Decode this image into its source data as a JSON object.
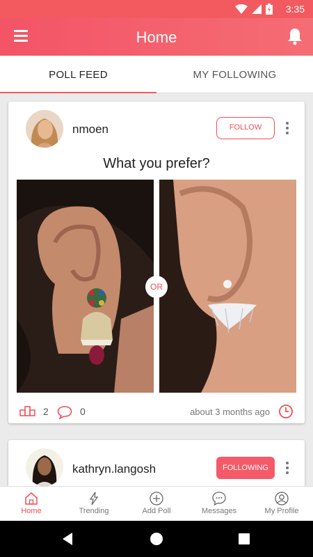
{
  "status_bar": {
    "time": "3:35"
  },
  "app_bar": {
    "title": "Home"
  },
  "tabs": [
    {
      "label": "POLL FEED",
      "active": true
    },
    {
      "label": "MY FOLLOWING",
      "active": false
    }
  ],
  "posts": [
    {
      "username": "nmoen",
      "follow_label": "FOLLOW",
      "question": "What you prefer?",
      "or_label": "OR",
      "votes": "2",
      "comments": "0",
      "time_ago": "about 3 months ago"
    },
    {
      "username": "kathryn.langosh",
      "follow_label": "FOLLOWING"
    }
  ],
  "bottom_nav": [
    {
      "label": "Home",
      "icon": "home-icon",
      "active": true
    },
    {
      "label": "Trending",
      "icon": "lightning-icon"
    },
    {
      "label": "Add Poll",
      "icon": "plus-circle-icon"
    },
    {
      "label": "Messages",
      "icon": "chat-icon"
    },
    {
      "label": "My Profile",
      "icon": "profile-icon"
    }
  ],
  "colors": {
    "accent": "#f25a5f",
    "following_bg": "#f45a68"
  }
}
